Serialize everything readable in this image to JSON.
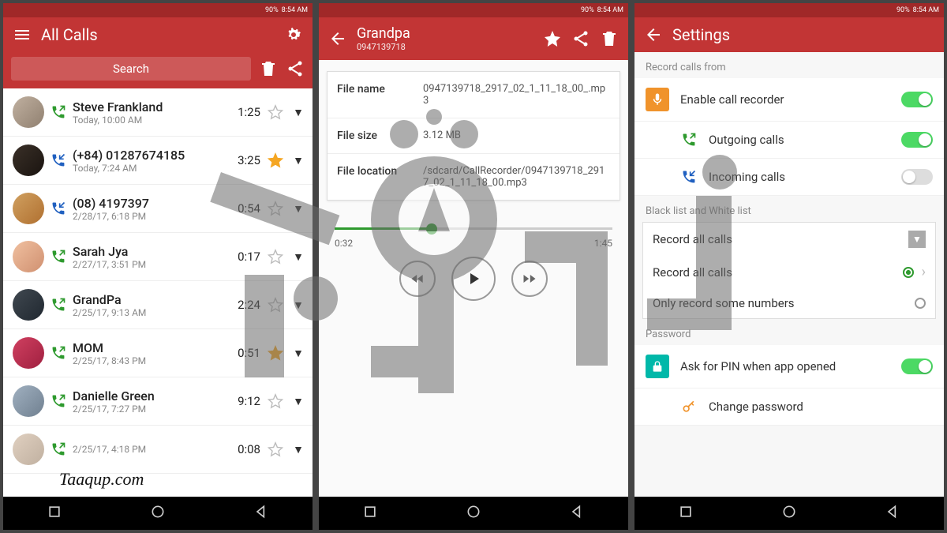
{
  "statusbar": {
    "signal": "90%",
    "time": "8:54 AM"
  },
  "screen1": {
    "title": "All Calls",
    "searchPlaceholder": "Search",
    "calls": [
      {
        "name": "Steve Frankland",
        "date": "Today, 10:00 AM",
        "dur": "1:25",
        "star": false,
        "dir": "out"
      },
      {
        "name": "(+84) 01287674185",
        "date": "Today, 7:24 AM",
        "dur": "3:25",
        "star": true,
        "dir": "in"
      },
      {
        "name": "(08) 4197397",
        "date": "2/28/17, 6:18 PM",
        "dur": "0:54",
        "star": false,
        "dir": "in"
      },
      {
        "name": "Sarah Jya",
        "date": "2/27/17, 3:51 PM",
        "dur": "0:17",
        "star": false,
        "dir": "out"
      },
      {
        "name": "GrandPa",
        "date": "2/25/17, 9:13 AM",
        "dur": "2:24",
        "star": false,
        "dir": "out"
      },
      {
        "name": "MOM",
        "date": "2/25/17, 8:43 PM",
        "dur": "0:51",
        "star": true,
        "dir": "out"
      },
      {
        "name": "Danielle Green",
        "date": "2/25/17, 7:27 PM",
        "dur": "9:12",
        "star": false,
        "dir": "out"
      },
      {
        "name": "",
        "date": "2/25/17, 4:18 PM",
        "dur": "0:08",
        "star": false,
        "dir": "out"
      }
    ]
  },
  "screen2": {
    "title": "Grandpa",
    "subtitle": "0947139718",
    "filenameLabel": "File name",
    "filenameValue": "0947139718_2917_02_1_11_18_00_.mp3",
    "sizeLabel": "File size",
    "sizeValue": "3.12 MB",
    "locationLabel": "File location",
    "locationValue": "/sdcard/CallRecorder/0947139718_2917_02_1_11_18_00.mp3",
    "elapsed": "0:32",
    "total": "1:45"
  },
  "screen3": {
    "title": "Settings",
    "secRecord": "Record calls from",
    "enable": "Enable call recorder",
    "outgoing": "Outgoing calls",
    "incoming": "Incoming calls",
    "secBW": "Black list and White list",
    "dropSelected": "Record all calls",
    "opt1": "Record all calls",
    "opt2": "Only record some numbers",
    "secPassword": "Password",
    "askPin": "Ask for PIN when app opened",
    "changePwd": "Change password"
  },
  "watermark": "Taaqup.com"
}
